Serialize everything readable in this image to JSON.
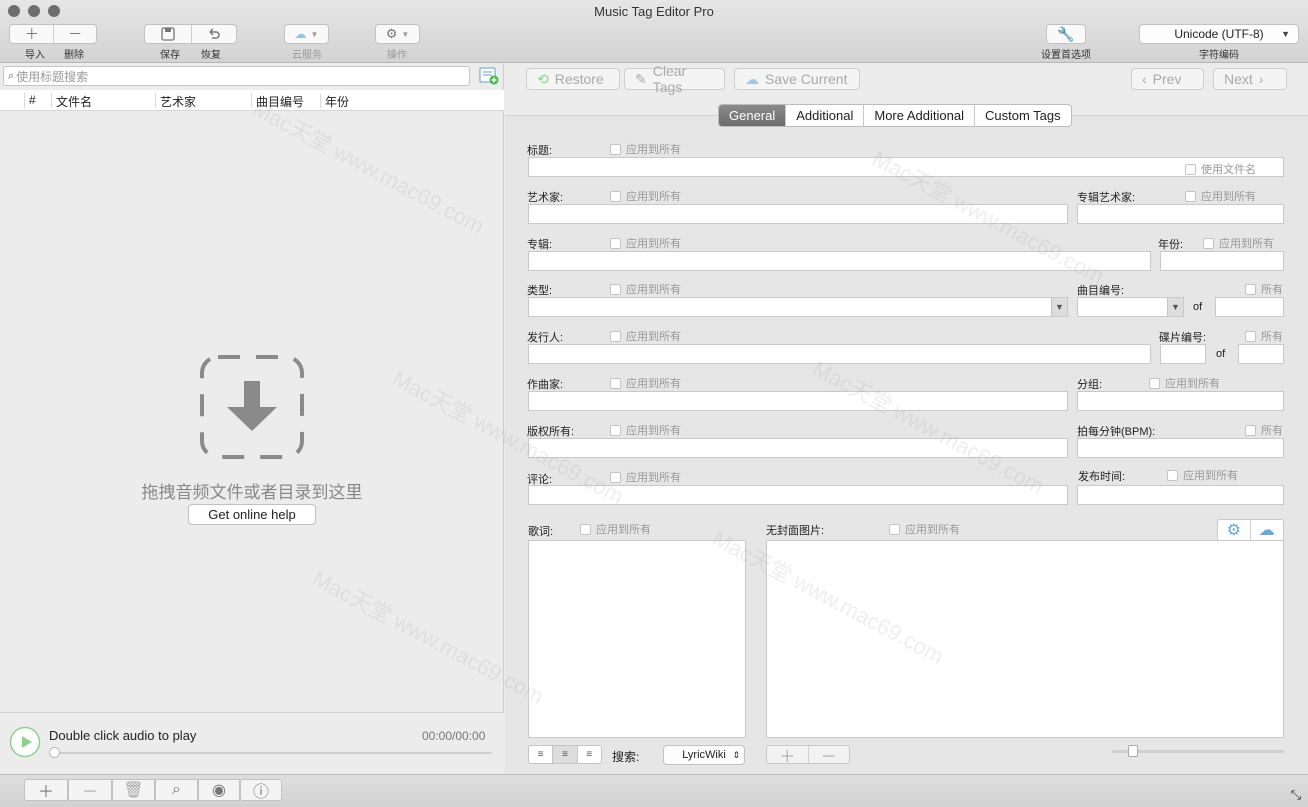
{
  "window": {
    "title": "Music Tag Editor Pro"
  },
  "toolbar": {
    "import_label": "导入",
    "delete_label": "删除",
    "save_label": "保存",
    "restore_label": "恢复",
    "cloud_label": "云服务",
    "actions_label": "操作",
    "prefs_label": "设置首选项",
    "encoding_value": "Unicode (UTF-8)",
    "encoding_label": "字符编码"
  },
  "left": {
    "search_placeholder": "使用标题搜索",
    "columns": [
      "#",
      "文件名",
      "艺术家",
      "曲目编号",
      "年份"
    ],
    "drop_text": "拖拽音频文件或者目录到这里",
    "help_button": "Get online help",
    "player_text": "Double click audio to play",
    "player_time": "00:00/00:00"
  },
  "right": {
    "restore": "Restore",
    "clear_tags": "Clear Tags",
    "save_current": "Save Current",
    "prev": "Prev",
    "next": "Next",
    "tabs": [
      "General",
      "Additional",
      "More Additional",
      "Custom Tags"
    ],
    "active_tab": "General"
  },
  "form": {
    "apply_all": "应用到所有",
    "all_short": "所有",
    "use_filename": "使用文件名",
    "of": "of",
    "title": "标题:",
    "artist": "艺术家:",
    "album_artist": "专辑艺术家:",
    "album": "专辑:",
    "year": "年份:",
    "genre": "类型:",
    "track_number": "曲目编号:",
    "publisher": "发行人:",
    "disc_number": "碟片编号:",
    "composer": "作曲家:",
    "grouping": "分组:",
    "copyright": "版权所有:",
    "bpm": "拍每分钟(BPM):",
    "comment": "评论:",
    "release_time": "发布时间:",
    "lyrics": "歌词:",
    "no_cover": "无封面图片:",
    "search_label": "搜索:",
    "lyrics_source": "LyricWiki"
  },
  "watermark": {
    "text": "Mac天堂 www.mac69.com"
  }
}
